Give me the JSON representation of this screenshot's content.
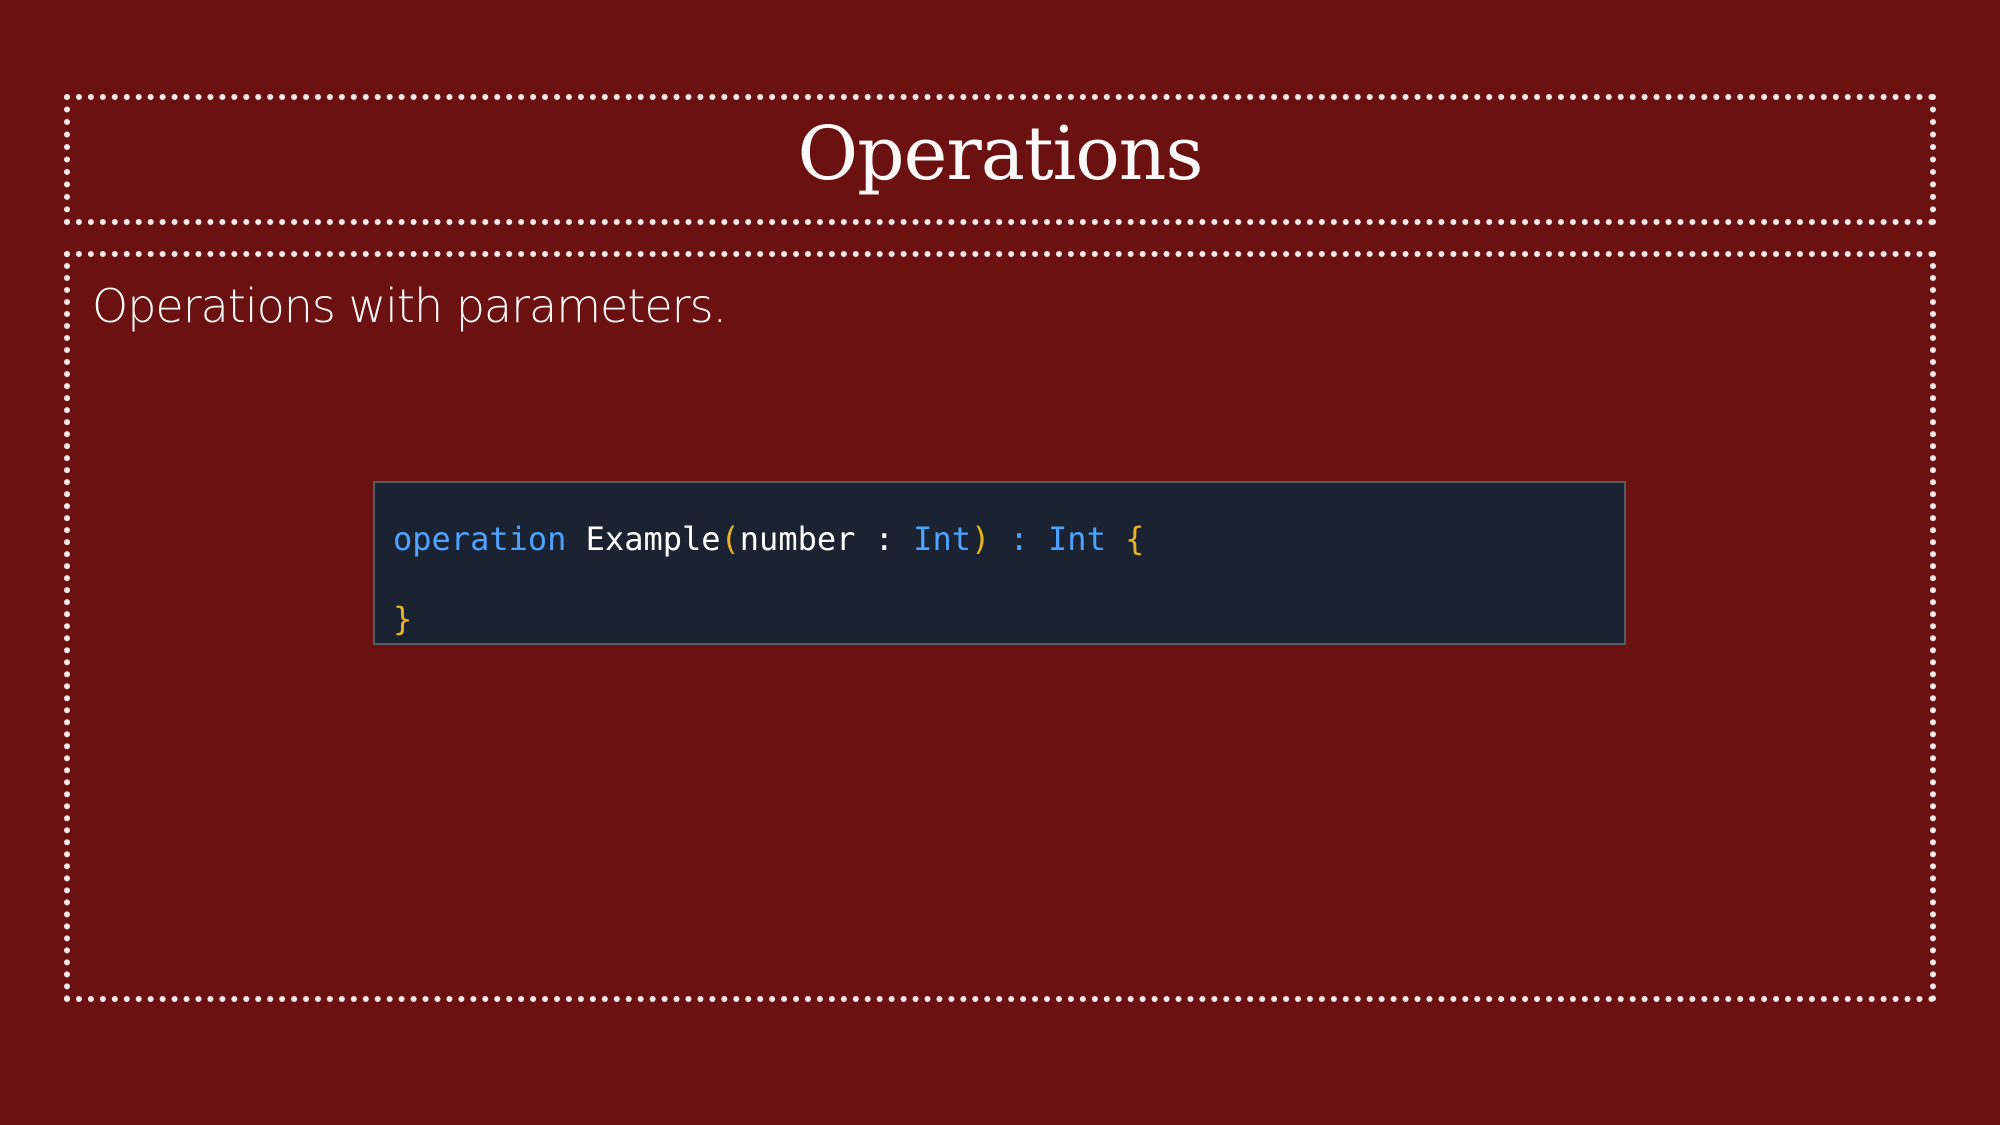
{
  "slide": {
    "title": "Operations",
    "subtitle": "Operations with parameters."
  },
  "code": {
    "line1": {
      "keyword": "operation",
      "space1": " ",
      "name": "Example",
      "open_paren": "(",
      "param": "number",
      "colon1": " : ",
      "param_type": "Int",
      "close_paren": ")",
      "colon2": " : ",
      "return_type": "Int",
      "space2": " ",
      "open_brace": "{"
    },
    "line2": {
      "close_brace": "}"
    }
  },
  "colors": {
    "background": "#6b1111",
    "frame": "#f3eaea",
    "code_background": "#1b2333",
    "keyword": "#4da3ff",
    "bracket": "#e6b422",
    "text": "#ffffff"
  }
}
